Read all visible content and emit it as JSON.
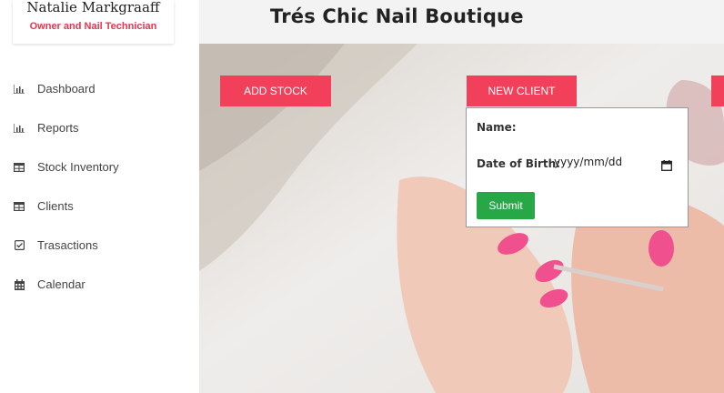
{
  "brand": {
    "name": "Natalie Markgraaff",
    "role": "Owner and Nail Technician"
  },
  "header": {
    "title": "Trés Chic Nail Boutique"
  },
  "sidebar": {
    "items": [
      {
        "label": "Dashboard",
        "icon": "bar-chart-icon"
      },
      {
        "label": "Reports",
        "icon": "bar-chart-icon"
      },
      {
        "label": "Stock Inventory",
        "icon": "table-icon"
      },
      {
        "label": "Clients",
        "icon": "table-icon"
      },
      {
        "label": "Trasactions",
        "icon": "checkbox-icon"
      },
      {
        "label": "Calendar",
        "icon": "calendar-icon"
      }
    ]
  },
  "toolbar": {
    "add_stock_label": "ADD STOCK",
    "new_client_label": "NEW CLIENT"
  },
  "new_client_form": {
    "name_label": "Name:",
    "dob_label": "Date of Birth:",
    "dob_value": "yyyy/mm/dd",
    "submit_label": "Submit"
  },
  "colors": {
    "accent": "#f2405a",
    "brand_role": "#e8344d",
    "submit": "#27a745"
  }
}
